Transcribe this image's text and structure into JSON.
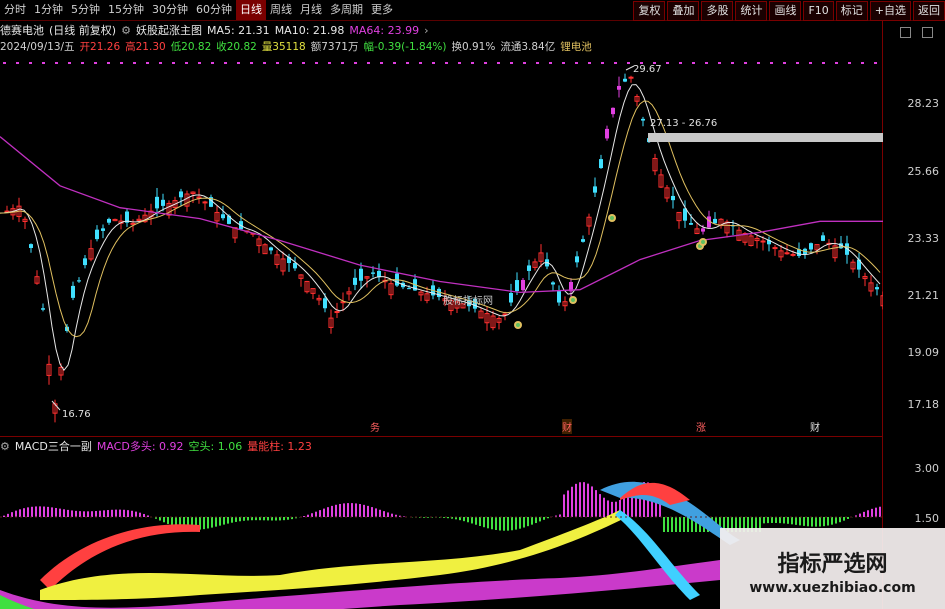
{
  "toolbar": {
    "periods": [
      "分时",
      "1分钟",
      "5分钟",
      "15分钟",
      "30分钟",
      "60分钟",
      "日线",
      "周线",
      "月线",
      "多周期",
      "更多"
    ],
    "active_index": 6,
    "right_buttons": [
      "复权",
      "叠加",
      "多股",
      "统计",
      "画线",
      "F10",
      "标记",
      "+自选",
      "返回"
    ]
  },
  "info_line1": {
    "stock_name": "德赛电池",
    "mode": "(日线 前复权)",
    "indicator_name": "妖股起涨主图",
    "ma5": "MA5: 21.31",
    "ma10": "MA10: 21.98",
    "ma64": "MA64: 23.99"
  },
  "info_line2": {
    "date": "2024/09/13/五",
    "open": "开21.26",
    "high": "高21.30",
    "low": "低20.82",
    "close": "收20.82",
    "volume": "量35118",
    "amount": "额7371万",
    "change": "幅-0.39(-1.84%)",
    "turnover": "换0.91%",
    "float_cap": "流通3.84亿",
    "sector": "锂电池"
  },
  "info_line3": {
    "indicator_name": "MACD三合一副",
    "bull": "MACD多头: 0.92",
    "bear": "空头: 1.06",
    "energy": "量能柱: 1.23"
  },
  "price_axis": [
    "28.23",
    "25.66",
    "23.33",
    "21.21",
    "19.09",
    "17.18"
  ],
  "macd_axis": [
    "3.00",
    "1.50"
  ],
  "annotations": {
    "high_label": "29.67",
    "range_label": "27.13 - 26.76",
    "low_label": "16.76",
    "center_watermark": "股标指标网"
  },
  "events": [
    "务",
    "财",
    "涨",
    "财"
  ],
  "watermark": {
    "title": "指标严选网",
    "url": "www.xuezhibiao.com"
  },
  "colors": {
    "up": "#ff3030",
    "down": "#40e0ff",
    "ma64": "#c030c0",
    "ma_white": "#e8e8e8",
    "ma_yellow": "#e0c060",
    "magenta_bar": "#e040e0"
  }
}
